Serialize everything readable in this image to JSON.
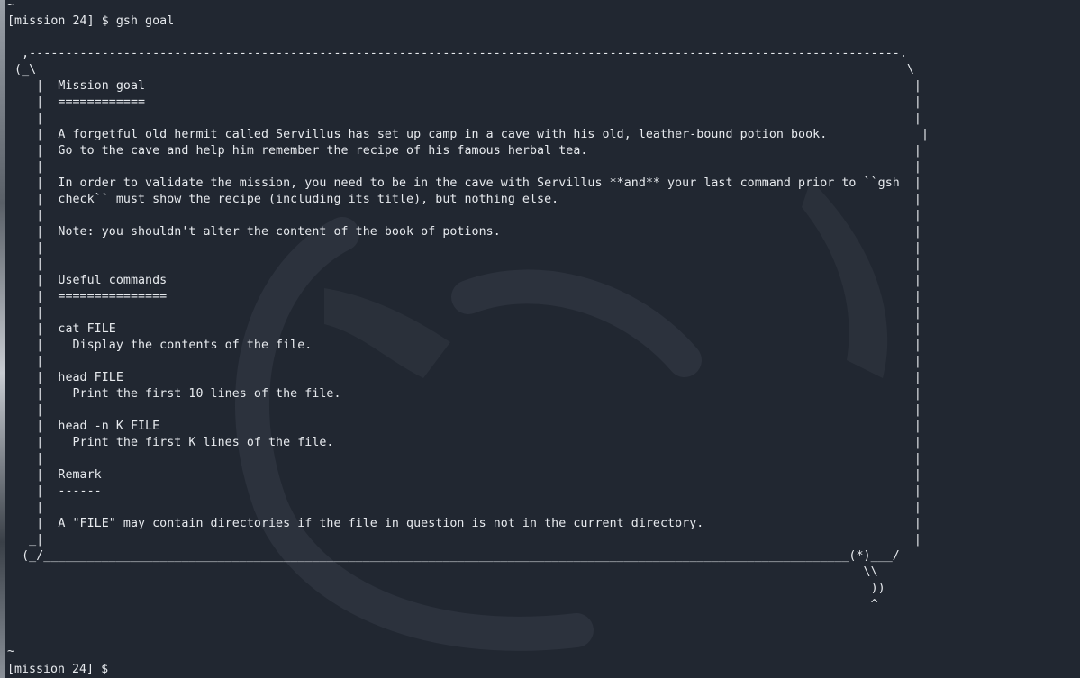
{
  "terminal": {
    "top_tilde": "~",
    "command_prompt": "[mission 24] $ gsh goal",
    "scroll_lines": [
      "",
      "  ,------------------------------------------------------------------------------------------------------------------------.",
      " (_\\                                                                                                                        \\",
      "    |  Mission goal                                                                                                          |",
      "    |  ============                                                                                                          |",
      "    |                                                                                                                        |",
      "    |  A forgetful old hermit called Servillus has set up camp in a cave with his old, leather-bound potion book.             |",
      "    |  Go to the cave and help him remember the recipe of his famous herbal tea.                                             |",
      "    |                                                                                                                        |",
      "    |  In order to validate the mission, you need to be in the cave with Servillus **and** your last command prior to ``gsh  |",
      "    |  check`` must show the recipe (including its title), but nothing else.                                                 |",
      "    |                                                                                                                        |",
      "    |  Note: you shouldn't alter the content of the book of potions.                                                         |",
      "    |                                                                                                                        |",
      "    |                                                                                                                        |",
      "    |  Useful commands                                                                                                       |",
      "    |  ===============                                                                                                       |",
      "    |                                                                                                                        |",
      "    |  cat FILE                                                                                                              |",
      "    |    Display the contents of the file.                                                                                   |",
      "    |                                                                                                                        |",
      "    |  head FILE                                                                                                             |",
      "    |    Print the first 10 lines of the file.                                                                               |",
      "    |                                                                                                                        |",
      "    |  head -n K FILE                                                                                                        |",
      "    |    Print the first K lines of the file.                                                                                |",
      "    |                                                                                                                        |",
      "    |  Remark                                                                                                                |",
      "    |  ------                                                                                                                |",
      "    |                                                                                                                        |",
      "    |  A \"FILE\" may contain directories if the file in question is not in the current directory.                             |",
      "   _|                                                                                                                        |",
      "  (_/_______________________________________________________________________________________________________________(*)___/",
      "                                                                                                                      \\\\",
      "                                                                                                                       ))",
      "                                                                                                                       ^"
    ],
    "bottom_tilde": "~",
    "bottom_prompt": "[mission 24] $ "
  },
  "colors": {
    "background": "#212731",
    "text": "#e7eaee"
  },
  "icons": {
    "background_art": "dragon-logo-icon"
  }
}
